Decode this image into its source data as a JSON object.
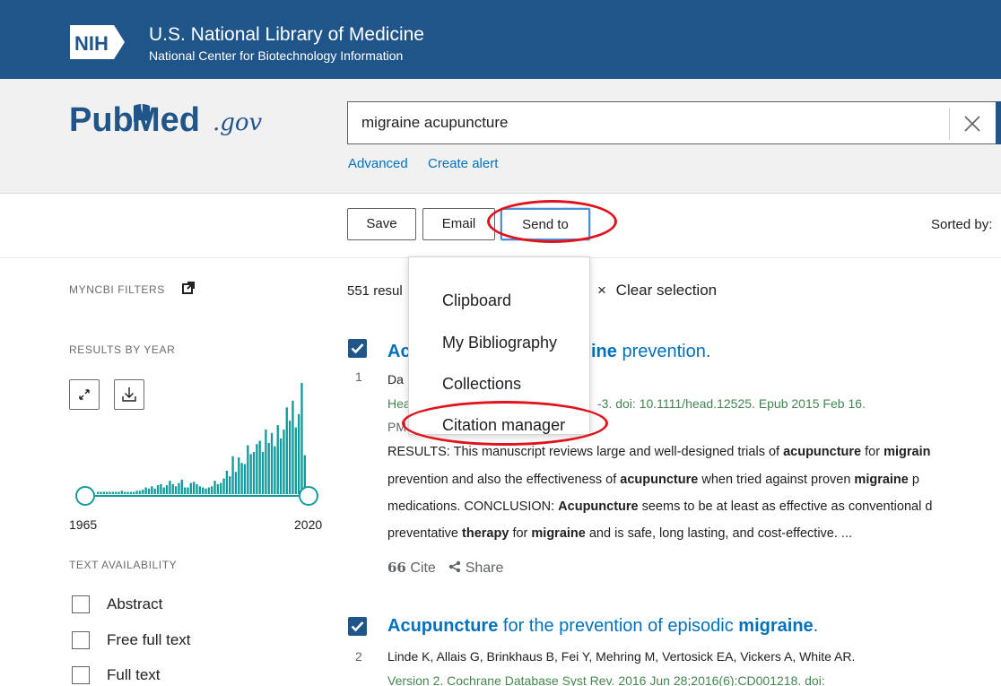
{
  "nih": {
    "logo_text": "NIH",
    "title": "U.S. National Library of Medicine",
    "subtitle": "National Center for Biotechnology Information"
  },
  "logo": {
    "pub": "Pub",
    "med": "Med",
    "gov": ".gov"
  },
  "search": {
    "query": "migraine acupuncture",
    "advanced_label": "Advanced",
    "create_alert_label": "Create alert"
  },
  "toolbar": {
    "save_label": "Save",
    "email_label": "Email",
    "send_to_label": "Send to",
    "sorted_label": "Sorted by:"
  },
  "send_to_menu": {
    "items": [
      "Clipboard",
      "My Bibliography",
      "Collections",
      "Citation manager"
    ]
  },
  "sidebar": {
    "myncbi_filters": "MYNCBI FILTERS",
    "results_by_year": "RESULTS BY YEAR",
    "year_start": "1965",
    "year_end": "2020",
    "text_availability": "TEXT AVAILABILITY",
    "filters": [
      "Abstract",
      "Free full text",
      "Full text"
    ],
    "histogram_color": "#139b9b",
    "histogram_values": [
      0.02,
      0.02,
      0.02,
      0.02,
      0.02,
      0.02,
      0.02,
      0.02,
      0.03,
      0.02,
      0.02,
      0.02,
      0.02,
      0.03,
      0.03,
      0.04,
      0.06,
      0.05,
      0.07,
      0.05,
      0.08,
      0.09,
      0.06,
      0.08,
      0.12,
      0.09,
      0.07,
      0.1,
      0.13,
      0.06,
      0.06,
      0.1,
      0.11,
      0.09,
      0.07,
      0.06,
      0.05,
      0.06,
      0.07,
      0.12,
      0.09,
      0.1,
      0.14,
      0.21,
      0.16,
      0.34,
      0.2,
      0.33,
      0.28,
      0.27,
      0.44,
      0.36,
      0.38,
      0.45,
      0.48,
      0.38,
      0.58,
      0.46,
      0.55,
      0.43,
      0.62,
      0.5,
      0.58,
      0.78,
      0.66,
      0.84,
      0.6,
      0.72,
      1.0,
      0.35
    ]
  },
  "results": {
    "count_text": "551 resul",
    "clear_selection": "Clear selection",
    "clear_icon": "×",
    "items": [
      {
        "number": "1",
        "title_a": "Ac",
        "title_b": "ine",
        "title_c": " prevention.",
        "authors": "Da",
        "source_a": "Hea",
        "source_b": "-3. doi: 10.1111/head.12525. Epub 2015 Feb 16.",
        "pmid": "PM",
        "snippet_1_a": "RESULTS: This manuscript reviews large and well-designed trials of ",
        "snippet_1_b": "acupuncture",
        "snippet_1_c": " for ",
        "snippet_1_d": "migrain",
        "snippet_2_a": "prevention and also the effectiveness of ",
        "snippet_2_b": "acupuncture",
        "snippet_2_c": " when tried against proven ",
        "snippet_2_d": "migraine",
        "snippet_2_e": " p",
        "snippet_3_a": "medications. CONCLUSION: ",
        "snippet_3_b": "Acupuncture",
        "snippet_3_c": " seems to be at least as effective as conventional d",
        "snippet_4_a": "preventative ",
        "snippet_4_b": "therapy",
        "snippet_4_c": " for ",
        "snippet_4_d": "migraine",
        "snippet_4_e": " and is safe, long lasting, and cost-effective. ...",
        "cite_icon": "66",
        "cite_label": "Cite",
        "share_label": "Share"
      },
      {
        "number": "2",
        "title_a": "Acupuncture",
        "title_b": " for the prevention of episodic ",
        "title_c": "migraine",
        "title_d": ".",
        "authors": "Linde K, Allais G, Brinkhaus B, Fei Y, Mehring M, Vertosick EA, Vickers A, White AR.",
        "source": "Version 2. Cochrane Database Syst Rev. 2016 Jun 28;2016(6):CD001218. doi:"
      }
    ]
  },
  "annotation_color": "#e0131d"
}
